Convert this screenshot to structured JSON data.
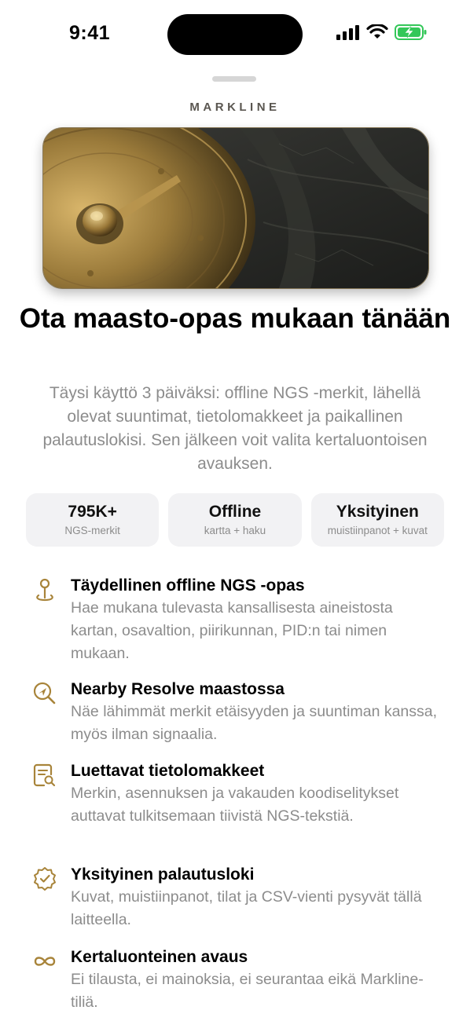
{
  "status_bar": {
    "time": "9:41"
  },
  "brand": "MARKLINE",
  "headline": "Ota maasto-opas mukaan tänään",
  "subtitle": "Täysi käyttö 3 päiväksi: offline NGS -merkit, lähellä olevat suuntimat, tietolomakkeet ja paikallinen palautuslokisi. Sen jälkeen voit valita kertaluontoisen avauksen.",
  "stats": [
    {
      "value": "795K+",
      "label": "NGS-merkit"
    },
    {
      "value": "Offline",
      "label": "kartta + haku"
    },
    {
      "value": "Yksityinen",
      "label": "muistiinpanot + kuvat"
    }
  ],
  "features": [
    {
      "icon": "map-pin-icon",
      "title": "Täydellinen offline NGS -opas",
      "desc": "Hae mukana tulevasta kansallisesta aineistosta kartan, osavaltion, piirikunnan, PID:n tai nimen mukaan."
    },
    {
      "icon": "search-location-icon",
      "title": "Nearby Resolve maastossa",
      "desc": "Näe lähimmät merkit etäisyyden ja suuntiman kanssa, myös ilman signaalia."
    },
    {
      "icon": "document-search-icon",
      "title": "Luettavat tietolomakkeet",
      "desc": "Merkin, asennuksen ja vakauden koodiselitykset auttavat tulkitsemaan tiivistä NGS-tekstiä."
    },
    {
      "icon": "verified-badge-icon",
      "title": "Yksityinen palautusloki",
      "desc": "Kuvat, muistiinpanot, tilat ja CSV-vienti pysyvät tällä laitteella."
    },
    {
      "icon": "infinity-icon",
      "title": "Kertaluonteinen avaus",
      "desc": "Ei tilausta, ei mainoksia, ei seurantaa eikä Markline-tiliä."
    }
  ],
  "colors": {
    "accent": "#a8843a",
    "battery": "#34c759",
    "muted": "#8c8c8c",
    "card": "#f2f2f4"
  }
}
